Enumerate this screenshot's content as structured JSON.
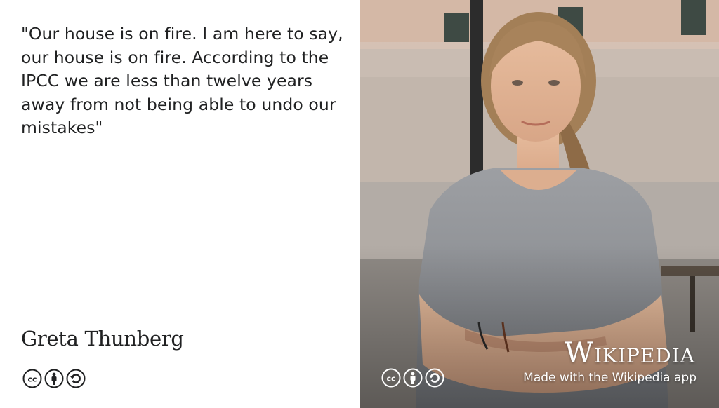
{
  "quote": {
    "text": "\"Our house is on fire. I am here to say, our house is on fire. According to the IPCC we are less than twelve years away from not being able to undo our mistakes\""
  },
  "author": {
    "name": "Greta Thunberg"
  },
  "license_icons": [
    "cc-icon",
    "by-icon",
    "sa-icon"
  ],
  "branding": {
    "wordmark": "Wikipedia",
    "made_with": "Made with the Wikipedia app"
  },
  "colors": {
    "text": "#202122",
    "divider": "#8a8f94",
    "overlay_text": "#ffffff"
  }
}
